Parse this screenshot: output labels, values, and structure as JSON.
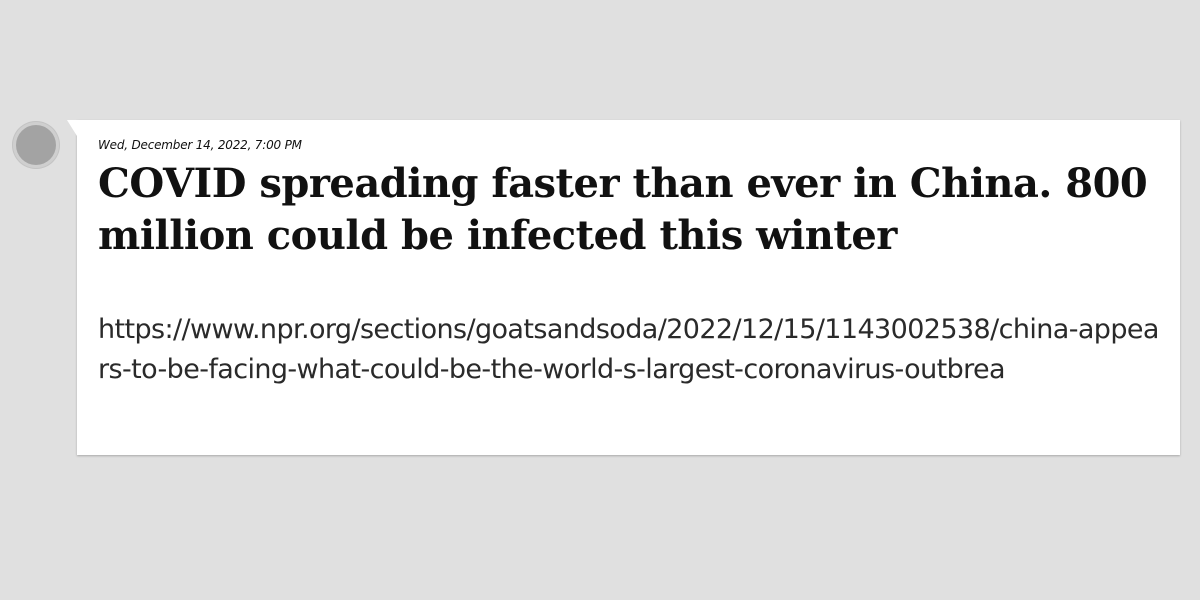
{
  "post": {
    "timestamp": "Wed, December 14, 2022, 7:00 PM",
    "headline": "COVID spreading faster than ever in China. 800 million could be infected this winter",
    "url": "https://www.npr.org/sections/goatsandsoda/2022/12/15/1143002538/china-appears-to-be-facing-what-could-be-the-world-s-largest-coronavirus-outbrea"
  },
  "colors": {
    "background": "#e0e0e0",
    "card": "#ffffff",
    "avatar": "#a3a3a3"
  },
  "icons": {
    "avatar": "user-avatar-placeholder"
  }
}
